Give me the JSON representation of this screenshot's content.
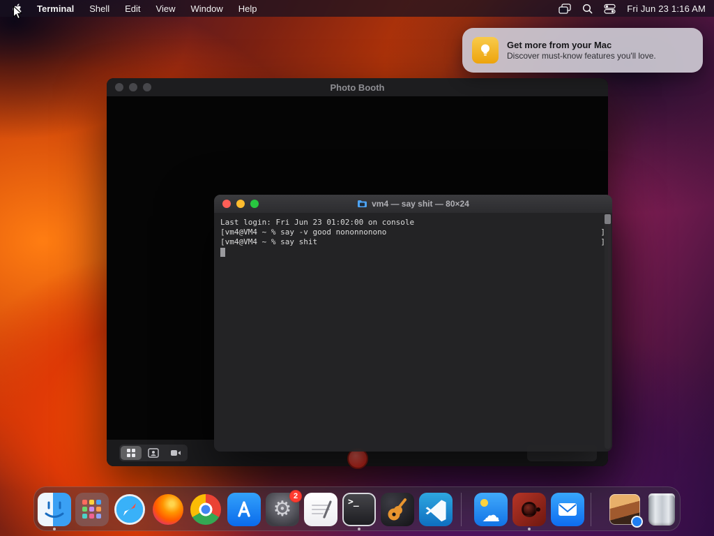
{
  "menu_bar": {
    "app_name": "Terminal",
    "menus": [
      "Shell",
      "Edit",
      "View",
      "Window",
      "Help"
    ],
    "status_icons": [
      "window-stack-icon",
      "spotlight-search-icon",
      "control-center-icon"
    ],
    "clock": "Fri Jun 23  1:16 AM"
  },
  "notification": {
    "icon": "tips-lightbulb-icon",
    "title": "Get more from your Mac",
    "body": "Discover must-know features you'll love."
  },
  "photo_booth": {
    "title": "Photo Booth",
    "toolbar_icons": [
      "grid-view-icon",
      "single-view-icon",
      "video-icon"
    ],
    "record_color": "#d92b20"
  },
  "terminal": {
    "title": "vm4 — say shit — 80×24",
    "lines": [
      {
        "text": "Last login: Fri Jun 23 01:02:00 on console",
        "right": ""
      },
      {
        "text": "[vm4@VM4 ~ % say -v good nononnonono",
        "right": "]"
      },
      {
        "text": "[vm4@VM4 ~ % say shit",
        "right": "]"
      }
    ]
  },
  "dock": {
    "items": [
      "finder",
      "launchpad",
      "safari",
      "firefox",
      "chrome",
      "app-store",
      "system-settings",
      "notes",
      "terminal",
      "garageband",
      "vscode",
      "weather",
      "photo-booth",
      "mail",
      "downloads-stack",
      "trash"
    ],
    "running": [
      "finder",
      "terminal",
      "photo-booth"
    ],
    "settings_badge": "2",
    "terminal_glyph": ">_"
  },
  "icon_glyphs": {
    "gear": "⚙",
    "cloud": "☁"
  }
}
